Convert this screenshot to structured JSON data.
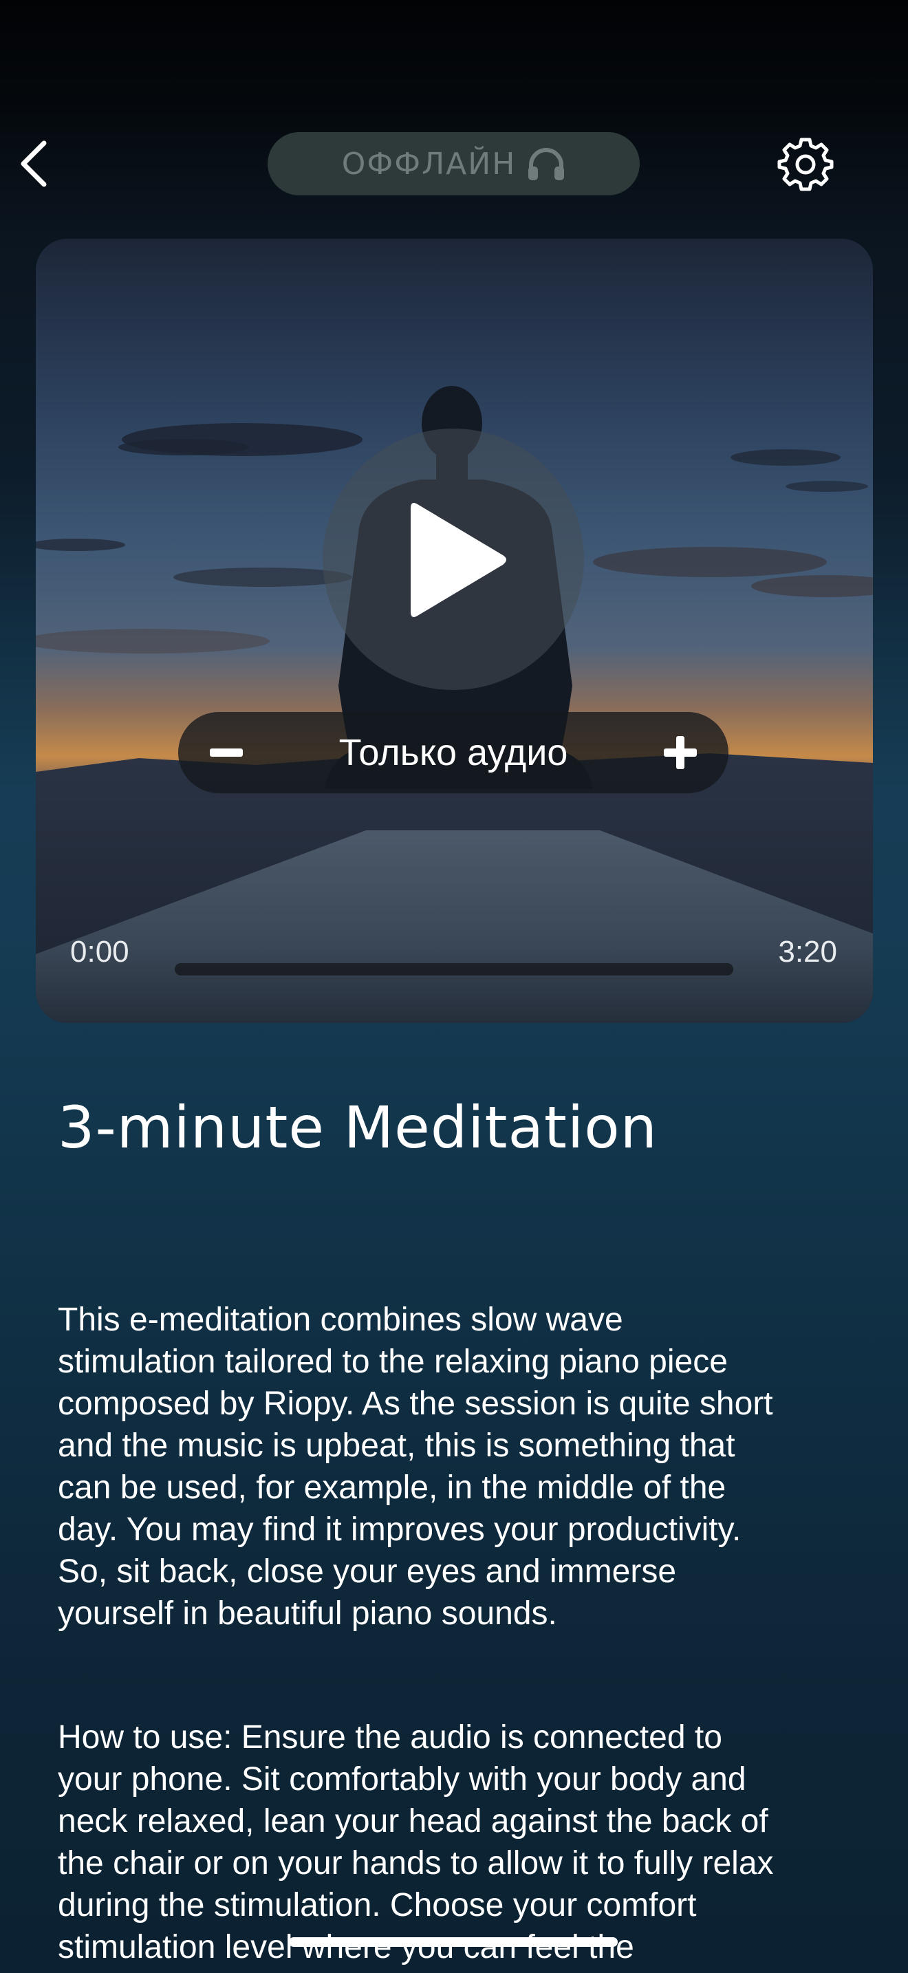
{
  "header": {
    "back_icon": "chevron-left-icon",
    "offline_label": "ОФФЛАЙН",
    "offline_icon": "headphones-icon",
    "settings_icon": "gear-icon"
  },
  "player": {
    "play_icon": "play-icon",
    "mode_label": "Только аудио",
    "minus_icon": "minus-icon",
    "plus_icon": "plus-icon",
    "time_current": "0:00",
    "time_total": "3:20",
    "progress": 0
  },
  "content": {
    "title": "3-minute Meditation",
    "description_lines": [
      "This e-meditation combines slow wave",
      "stimulation tailored to the relaxing piano piece",
      "composed by Riopy. As the session is quite short",
      "and the music is upbeat, this is something that",
      "can be used, for example, in the middle of the",
      "day. You may find it improves your productivity.",
      "So, sit back, close your eyes and immerse",
      "yourself in beautiful piano sounds."
    ],
    "how_to_lines": [
      "How to use: Ensure the audio is connected to",
      "your phone. Sit comfortably with your body and",
      "neck relaxed, lean your head against the back of",
      "the chair or on your hands to allow it to fully relax",
      "during the stimulation. Choose your comfort",
      "stimulation level where you can feel the"
    ]
  },
  "colors": {
    "offline_pill_bg": "#2d3a39",
    "offline_text": "#6f7c7b",
    "accent": "#ffffff"
  }
}
